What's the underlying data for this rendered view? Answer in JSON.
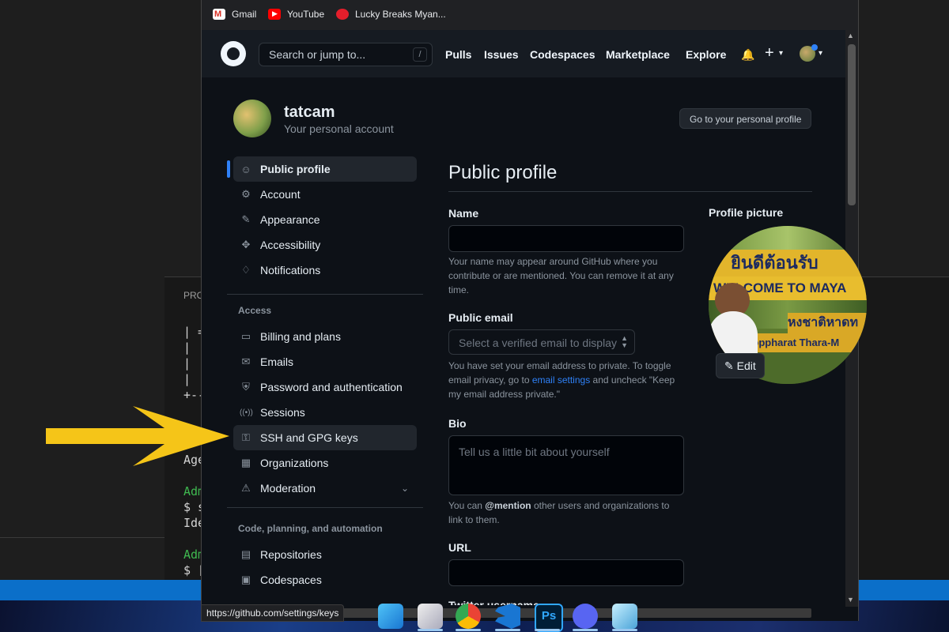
{
  "bookmarks": [
    {
      "label": "Gmail",
      "icon": "gmail-icon"
    },
    {
      "label": "YouTube",
      "icon": "youtube-icon"
    },
    {
      "label": "Lucky Breaks Myan...",
      "icon": "coca-cola-icon"
    }
  ],
  "header": {
    "search_placeholder": "Search or jump to...",
    "search_key": "/",
    "nav": [
      "Pulls",
      "Issues",
      "Codespaces",
      "Marketplace",
      "Explore"
    ],
    "bell": "🔔",
    "plus": "+",
    "caret": "▾"
  },
  "account": {
    "username": "tatcam",
    "subtitle": "Your personal account",
    "go_profile_label": "Go to your personal profile"
  },
  "sidebar": {
    "items": [
      {
        "label": "Public profile",
        "icon": "person-icon",
        "glyph": "👤"
      },
      {
        "label": "Account",
        "icon": "gear-icon",
        "glyph": "⚙"
      },
      {
        "label": "Appearance",
        "icon": "paintbrush-icon",
        "glyph": "🖌"
      },
      {
        "label": "Accessibility",
        "icon": "accessibility-icon",
        "glyph": "♿"
      },
      {
        "label": "Notifications",
        "icon": "bell-icon",
        "glyph": "🔔"
      }
    ],
    "access_heading": "Access",
    "access_items": [
      {
        "label": "Billing and plans",
        "icon": "credit-card-icon",
        "glyph": "▭"
      },
      {
        "label": "Emails",
        "icon": "mail-icon",
        "glyph": "✉"
      },
      {
        "label": "Password and authentication",
        "icon": "shield-icon",
        "glyph": "⛨"
      },
      {
        "label": "Sessions",
        "icon": "broadcast-icon",
        "glyph": "((•))"
      },
      {
        "label": "SSH and GPG keys",
        "icon": "key-icon",
        "glyph": "⚿"
      },
      {
        "label": "Organizations",
        "icon": "organization-icon",
        "glyph": "▦"
      },
      {
        "label": "Moderation",
        "icon": "report-icon",
        "glyph": "⚠"
      }
    ],
    "code_heading": "Code, planning, and automation",
    "code_items": [
      {
        "label": "Repositories",
        "icon": "repo-icon",
        "glyph": "▤"
      },
      {
        "label": "Codespaces",
        "icon": "codespaces-icon",
        "glyph": "▣"
      }
    ],
    "chevron": "⌄"
  },
  "main": {
    "title": "Public profile",
    "name_label": "Name",
    "name_value": "",
    "name_help": "Your name may appear around GitHub where you contribute or are mentioned. You can remove it at any time.",
    "email_label": "Public email",
    "email_placeholder": "Select a verified email to display",
    "email_help_1": "You have set your email address to private. To toggle email privacy, go to ",
    "email_help_link": "email settings",
    "email_help_2": " and uncheck \"Keep my email address private.\"",
    "bio_label": "Bio",
    "bio_placeholder": "Tell us a little bit about yourself",
    "bio_help_1": "You can ",
    "bio_help_mention": "@mention",
    "bio_help_2": " other users and organizations to link to them.",
    "url_label": "URL",
    "twitter_label_partial": "Twitter username"
  },
  "profile_picture": {
    "title": "Profile picture",
    "sign_line_1": "ยินดีต้อนรับ",
    "sign_line_2": "WELCOME TO MAYA",
    "sign_line_3": "หงชาติหาดท",
    "sign_line_4": "Noppharat Thara-M",
    "edit_label": "Edit"
  },
  "status_url": "https://github.com/settings/keys",
  "terminal": {
    "title": "PRO",
    "lines": [
      "| =",
      "|",
      "|",
      "|",
      "+--"
    ],
    "age": "Age",
    "adm1": "Adm",
    "cmd1": "$ s",
    "ide": "Ide",
    "adm2": "Adm",
    "cmd2": "$ ["
  },
  "taskbar": [
    "windows-start-icon",
    "file-explorer-icon",
    "chrome-icon",
    "vscode-icon",
    "photoshop-icon",
    "discord-icon",
    "notepad-icon"
  ],
  "colors": {
    "accent": "#2f81f7",
    "arrow": "#f5c518",
    "bg": "#0d1117"
  }
}
